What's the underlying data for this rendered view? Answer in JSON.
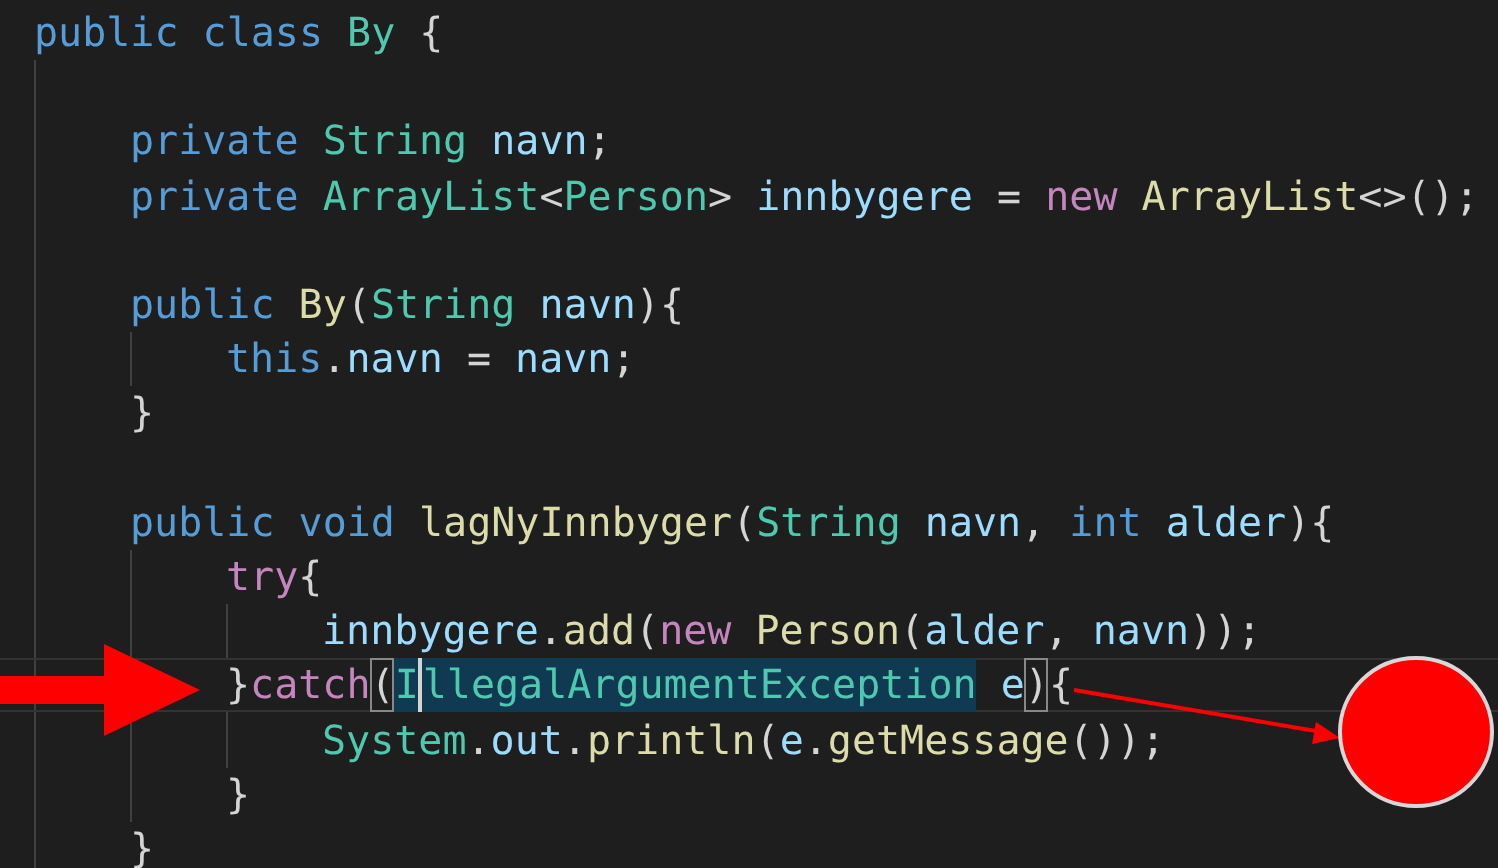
{
  "editor": {
    "lines": [
      {
        "kind": "code",
        "current": false,
        "tokens": [
          {
            "text": "public ",
            "kind": "keyword"
          },
          {
            "text": "class ",
            "kind": "keyword"
          },
          {
            "text": "By ",
            "kind": "type"
          },
          {
            "text": "{",
            "kind": "plain"
          }
        ],
        "children": [
          {
            "kind": "blank"
          },
          {
            "kind": "code",
            "current": false,
            "tokens": [
              {
                "text": "private ",
                "kind": "keyword"
              },
              {
                "text": "String ",
                "kind": "type"
              },
              {
                "text": "navn",
                "kind": "variable"
              },
              {
                "text": ";",
                "kind": "plain"
              }
            ]
          },
          {
            "kind": "code",
            "current": false,
            "tokens": [
              {
                "text": "private ",
                "kind": "keyword"
              },
              {
                "text": "ArrayList",
                "kind": "type"
              },
              {
                "text": "<",
                "kind": "plain"
              },
              {
                "text": "Person",
                "kind": "type"
              },
              {
                "text": "> ",
                "kind": "plain"
              },
              {
                "text": "innbygere ",
                "kind": "variable"
              },
              {
                "text": "= ",
                "kind": "plain"
              },
              {
                "text": "new ",
                "kind": "control"
              },
              {
                "text": "ArrayList",
                "kind": "function"
              },
              {
                "text": "<>();",
                "kind": "plain"
              }
            ]
          },
          {
            "kind": "blank"
          },
          {
            "kind": "code",
            "current": false,
            "tokens": [
              {
                "text": "public ",
                "kind": "keyword"
              },
              {
                "text": "By",
                "kind": "function"
              },
              {
                "text": "(",
                "kind": "plain"
              },
              {
                "text": "String ",
                "kind": "type"
              },
              {
                "text": "navn",
                "kind": "variable"
              },
              {
                "text": "){",
                "kind": "plain"
              }
            ],
            "children": [
              {
                "kind": "code",
                "current": false,
                "tokens": [
                  {
                    "text": "this",
                    "kind": "keyword"
                  },
                  {
                    "text": ".",
                    "kind": "plain"
                  },
                  {
                    "text": "navn ",
                    "kind": "variable"
                  },
                  {
                    "text": "= ",
                    "kind": "plain"
                  },
                  {
                    "text": "navn",
                    "kind": "variable"
                  },
                  {
                    "text": ";",
                    "kind": "plain"
                  }
                ]
              }
            ]
          },
          {
            "kind": "code",
            "current": false,
            "tokens": [
              {
                "text": "}",
                "kind": "plain"
              }
            ]
          },
          {
            "kind": "blank"
          },
          {
            "kind": "code",
            "current": false,
            "tokens": [
              {
                "text": "public ",
                "kind": "keyword"
              },
              {
                "text": "void ",
                "kind": "keyword"
              },
              {
                "text": "lagNyInnbyger",
                "kind": "function"
              },
              {
                "text": "(",
                "kind": "plain"
              },
              {
                "text": "String ",
                "kind": "type"
              },
              {
                "text": "navn",
                "kind": "variable"
              },
              {
                "text": ", ",
                "kind": "plain"
              },
              {
                "text": "int ",
                "kind": "keyword"
              },
              {
                "text": "alder",
                "kind": "variable"
              },
              {
                "text": "){",
                "kind": "plain"
              }
            ],
            "children": [
              {
                "kind": "code",
                "current": false,
                "tokens": [
                  {
                    "text": "try",
                    "kind": "control"
                  },
                  {
                    "text": "{",
                    "kind": "plain"
                  }
                ],
                "children": [
                  {
                    "kind": "code",
                    "current": false,
                    "tokens": [
                      {
                        "text": "innbygere",
                        "kind": "variable"
                      },
                      {
                        "text": ".",
                        "kind": "plain"
                      },
                      {
                        "text": "add",
                        "kind": "function"
                      },
                      {
                        "text": "(",
                        "kind": "plain"
                      },
                      {
                        "text": "new ",
                        "kind": "control"
                      },
                      {
                        "text": "Person",
                        "kind": "function"
                      },
                      {
                        "text": "(",
                        "kind": "plain"
                      },
                      {
                        "text": "alder",
                        "kind": "variable"
                      },
                      {
                        "text": ", ",
                        "kind": "plain"
                      },
                      {
                        "text": "navn",
                        "kind": "variable"
                      },
                      {
                        "text": "));",
                        "kind": "plain"
                      }
                    ]
                  }
                ]
              },
              {
                "kind": "code",
                "current": true,
                "tokens": [
                  {
                    "text": "}",
                    "kind": "plain"
                  },
                  {
                    "text": "catch",
                    "kind": "control"
                  },
                  {
                    "text": "(",
                    "kind": "bracket"
                  },
                  {
                    "text": "I",
                    "kind": "selected",
                    "cursor": true
                  },
                  {
                    "text": "llegalArgumentException",
                    "kind": "selected",
                    "cursor": false
                  },
                  {
                    "text": " e",
                    "kind": "variable"
                  },
                  {
                    "text": ")",
                    "kind": "bracket"
                  },
                  {
                    "text": "{",
                    "kind": "plain"
                  }
                ],
                "children": [
                  {
                    "kind": "code",
                    "current": false,
                    "tokens": [
                      {
                        "text": "System",
                        "kind": "type"
                      },
                      {
                        "text": ".",
                        "kind": "plain"
                      },
                      {
                        "text": "out",
                        "kind": "variable"
                      },
                      {
                        "text": ".",
                        "kind": "plain"
                      },
                      {
                        "text": "println",
                        "kind": "function"
                      },
                      {
                        "text": "(",
                        "kind": "plain"
                      },
                      {
                        "text": "e",
                        "kind": "variable"
                      },
                      {
                        "text": ".",
                        "kind": "plain"
                      },
                      {
                        "text": "getMessage",
                        "kind": "function"
                      },
                      {
                        "text": "());",
                        "kind": "plain"
                      }
                    ]
                  }
                ]
              },
              {
                "kind": "code",
                "current": false,
                "tokens": [
                  {
                    "text": "}",
                    "kind": "plain"
                  }
                ]
              }
            ]
          },
          {
            "kind": "code",
            "current": false,
            "tokens": [
              {
                "text": "}",
                "kind": "plain"
              }
            ]
          }
        ]
      }
    ]
  }
}
